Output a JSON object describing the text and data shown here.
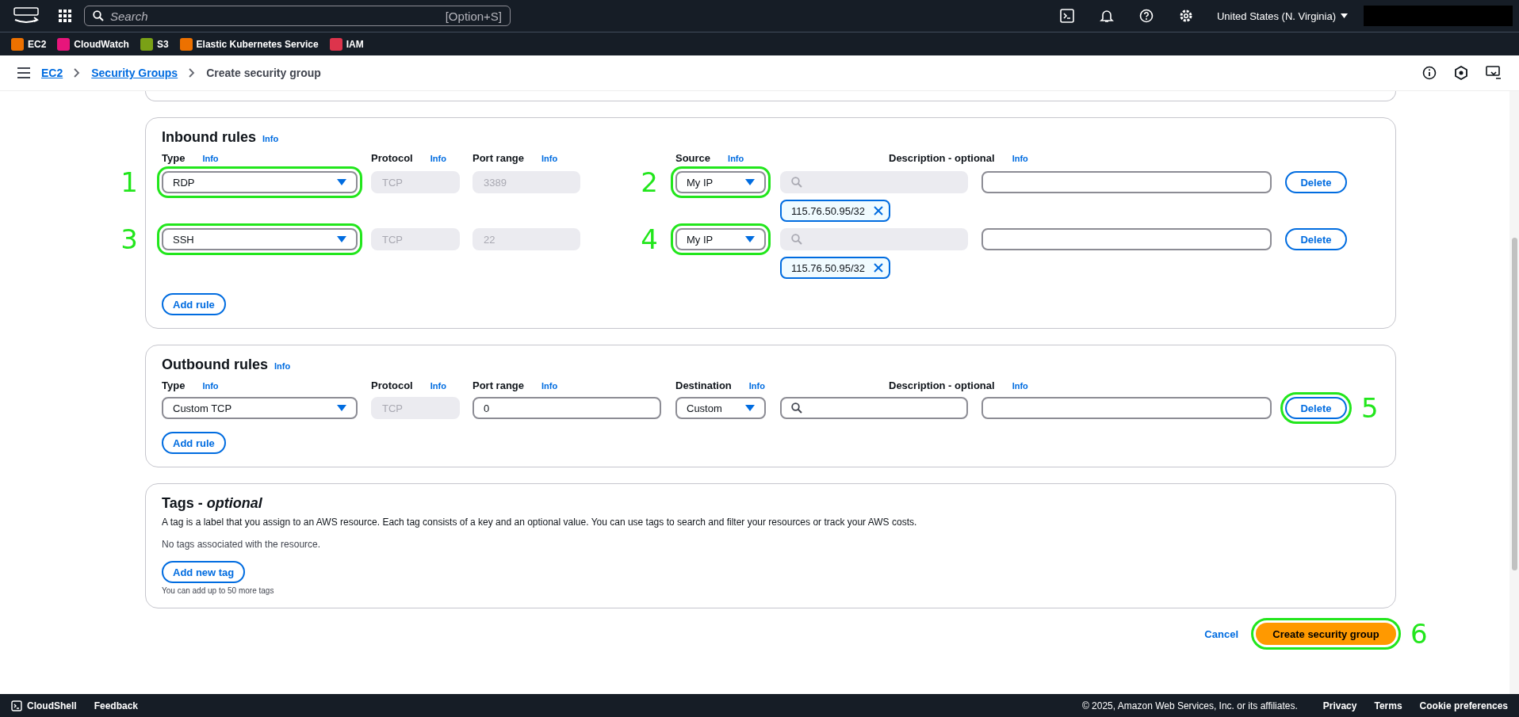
{
  "top_nav": {
    "search_placeholder": "Search",
    "search_shortcut": "[Option+S]",
    "region": "United States (N. Virginia)"
  },
  "favorites": [
    {
      "label": "EC2",
      "color": "#ed7100"
    },
    {
      "label": "CloudWatch",
      "color": "#e7157b"
    },
    {
      "label": "S3",
      "color": "#7aa116"
    },
    {
      "label": "Elastic Kubernetes Service",
      "color": "#ed7100"
    },
    {
      "label": "IAM",
      "color": "#dd344c"
    }
  ],
  "breadcrumbs": [
    {
      "label": "EC2",
      "link": true
    },
    {
      "label": "Security Groups",
      "link": true
    },
    {
      "label": "Create security group",
      "link": false
    }
  ],
  "inbound": {
    "title": "Inbound rules",
    "info": "Info",
    "columns": [
      {
        "label": "Type",
        "info": "Info"
      },
      {
        "label": "Protocol",
        "info": "Info"
      },
      {
        "label": "Port range",
        "info": "Info"
      },
      {
        "label": "Source",
        "info": "Info"
      },
      {
        "label": "Description - optional",
        "info": "Info"
      }
    ],
    "rules": [
      {
        "type": {
          "value": "RDP",
          "callout": "1"
        },
        "protocol": "TCP",
        "port_range": "3389",
        "port_disabled": true,
        "source": {
          "value": "My IP",
          "callout": "2"
        },
        "search_disabled": true,
        "chips": [
          "115.76.50.95/32"
        ],
        "delete": {
          "label": "Delete"
        }
      },
      {
        "type": {
          "value": "SSH",
          "callout": "3"
        },
        "protocol": "TCP",
        "port_range": "22",
        "port_disabled": true,
        "source": {
          "value": "My IP",
          "callout": "4"
        },
        "search_disabled": true,
        "chips": [
          "115.76.50.95/32"
        ],
        "delete": {
          "label": "Delete"
        }
      }
    ],
    "add_rule": "Add rule"
  },
  "outbound": {
    "title": "Outbound rules",
    "info": "Info",
    "columns": [
      {
        "label": "Type",
        "info": "Info"
      },
      {
        "label": "Protocol",
        "info": "Info"
      },
      {
        "label": "Port range",
        "info": "Info"
      },
      {
        "label": "Destination",
        "info": "Info"
      },
      {
        "label": "Description - optional",
        "info": "Info"
      }
    ],
    "rules": [
      {
        "type": {
          "value": "Custom TCP"
        },
        "protocol": "TCP",
        "port_range": "0",
        "port_disabled": false,
        "source": {
          "value": "Custom"
        },
        "search_disabled": false,
        "delete": {
          "label": "Delete",
          "callout": "5"
        }
      }
    ],
    "add_rule": "Add rule"
  },
  "tags": {
    "title": "Tags - ",
    "title_italic": "optional",
    "description": "A tag is a label that you assign to an AWS resource. Each tag consists of a key and an optional value. You can use tags to search and filter your resources or track your AWS costs.",
    "empty": "No tags associated with the resource.",
    "add_button": "Add new tag",
    "note": "You can add up to 50 more tags"
  },
  "actions": {
    "cancel": "Cancel",
    "create": {
      "label": "Create security group",
      "callout": "6"
    }
  },
  "footer": {
    "cloudshell": "CloudShell",
    "feedback": "Feedback",
    "copyright": "© 2025, Amazon Web Services, Inc. or its affiliates.",
    "links": [
      "Privacy",
      "Terms",
      "Cookie preferences"
    ]
  }
}
